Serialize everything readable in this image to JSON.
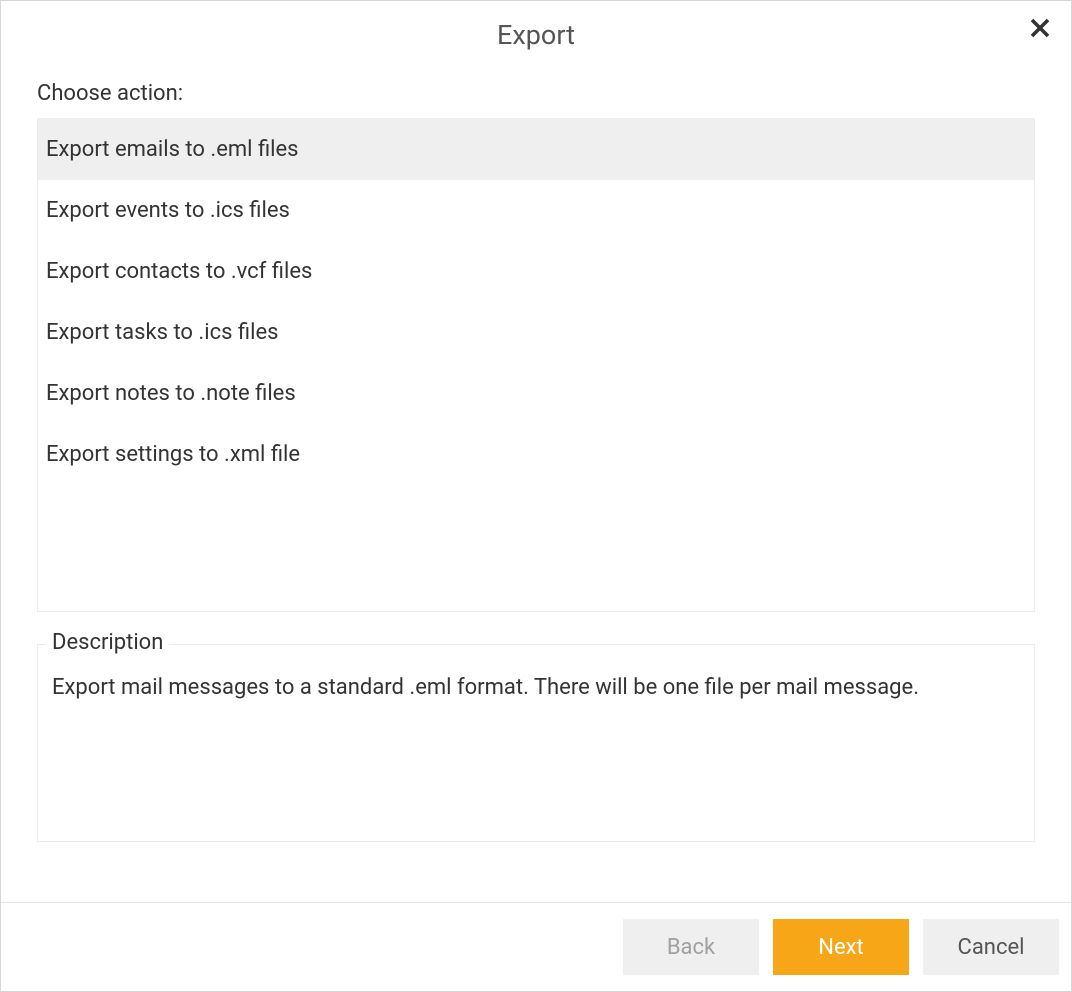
{
  "dialog": {
    "title": "Export",
    "choose_label": "Choose action:",
    "actions": [
      {
        "label": "Export emails to .eml files",
        "selected": true
      },
      {
        "label": "Export events to .ics files",
        "selected": false
      },
      {
        "label": "Export contacts to .vcf files",
        "selected": false
      },
      {
        "label": "Export tasks to .ics files",
        "selected": false
      },
      {
        "label": "Export notes to .note files",
        "selected": false
      },
      {
        "label": "Export settings to .xml file",
        "selected": false
      }
    ],
    "description": {
      "legend": "Description",
      "text": "Export mail messages to a standard .eml format. There will be one file per mail message."
    },
    "buttons": {
      "back": "Back",
      "next": "Next",
      "cancel": "Cancel"
    }
  }
}
